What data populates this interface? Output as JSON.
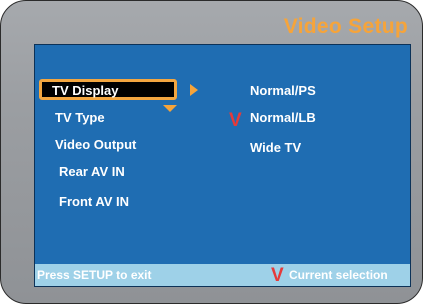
{
  "header": {
    "title": "Video Setup"
  },
  "menu": {
    "items": [
      {
        "label": "TV Display",
        "selected": true
      },
      {
        "label": "TV Type"
      },
      {
        "label": "Video Output"
      },
      {
        "label": "Rear AV IN"
      },
      {
        "label": "Front AV IN"
      }
    ]
  },
  "options": {
    "items": [
      {
        "label": "Normal/PS"
      },
      {
        "label": "Normal/LB",
        "current": true
      },
      {
        "label": "Wide TV"
      }
    ],
    "current_mark": "V"
  },
  "footer": {
    "hint": "Press SETUP to exit",
    "legend_mark": "V",
    "legend_label": "Current  selection"
  },
  "colors": {
    "title": "#f6a43a",
    "screen": "#1f6db2",
    "footer": "#9ed1e8",
    "highlight_border": "#f3a640",
    "check_mark": "#e53a3a"
  },
  "icons": {
    "submenu_arrow": "triangle-right-icon",
    "scroll_arrow": "triangle-down-icon"
  }
}
